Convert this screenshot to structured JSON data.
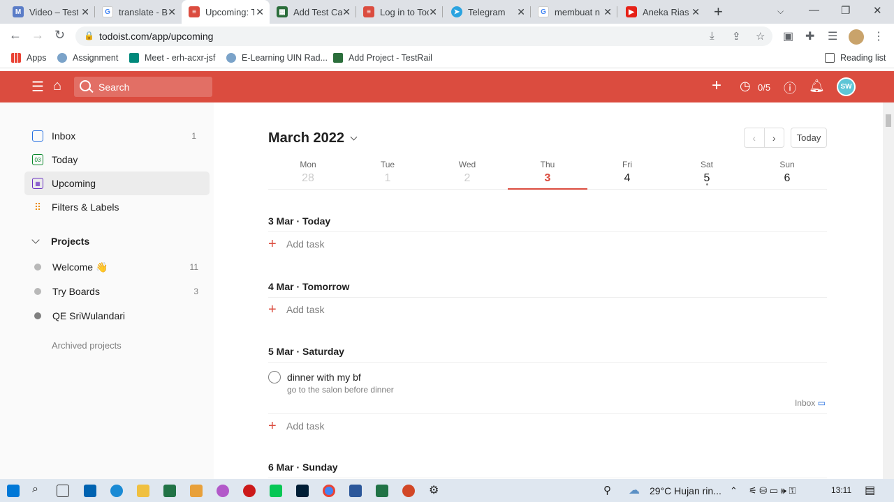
{
  "tabs": [
    {
      "title": "Video – Test",
      "favicon": "M",
      "color": "#5a7cc7"
    },
    {
      "title": "translate - Bing",
      "favicon": "G",
      "color": "#4285f4"
    },
    {
      "title": "Upcoming: Todoist",
      "favicon": "td",
      "color": "#db4c3f"
    },
    {
      "title": "Add Test Case",
      "favicon": "tr",
      "color": "#2b6e3b"
    },
    {
      "title": "Log in to Todoist",
      "favicon": "td",
      "color": "#db4c3f"
    },
    {
      "title": "Telegram",
      "favicon": "tg",
      "color": "#2aa3e0"
    },
    {
      "title": "membuat n",
      "favicon": "G",
      "color": "#4285f4"
    },
    {
      "title": "Aneka Rias",
      "favicon": "yt",
      "color": "#e62117"
    }
  ],
  "address": {
    "url": "todoist.com/app/upcoming"
  },
  "bookmarks": {
    "apps": "Apps",
    "items": [
      "Assignment",
      "Meet - erh-acxr-jsf",
      "E-Learning UIN Rad...",
      "Add Project - TestRail"
    ],
    "reading_list": "Reading list"
  },
  "header": {
    "search_placeholder": "Search",
    "karma": "0/5",
    "avatar_initials": "SW"
  },
  "sidebar": {
    "nav": [
      {
        "label": "Inbox",
        "count": "1",
        "icon": "inbox-icon",
        "color": "#246fe0"
      },
      {
        "label": "Today",
        "count": "",
        "icon": "calendar-today-icon",
        "color": "#058527"
      },
      {
        "label": "Upcoming",
        "count": "",
        "icon": "calendar-upcoming-icon",
        "color": "#692fc2"
      },
      {
        "label": "Filters & Labels",
        "count": "",
        "icon": "filters-icon",
        "color": "#eb8909"
      }
    ],
    "projects_heading": "Projects",
    "projects": [
      {
        "label": "Welcome 👋",
        "count": "11",
        "color": "#b8b8b8"
      },
      {
        "label": "Try Boards",
        "count": "3",
        "color": "#b8b8b8"
      },
      {
        "label": "QE SriWulandari",
        "count": "",
        "color": "#808080"
      }
    ],
    "archived": "Archived projects"
  },
  "main": {
    "month": "March 2022",
    "today_button": "Today",
    "week": [
      {
        "name": "Mon",
        "date": "28",
        "state": "past"
      },
      {
        "name": "Tue",
        "date": "1",
        "state": "past"
      },
      {
        "name": "Wed",
        "date": "2",
        "state": "past"
      },
      {
        "name": "Thu",
        "date": "3",
        "state": "today"
      },
      {
        "name": "Fri",
        "date": "4",
        "state": "future"
      },
      {
        "name": "Sat",
        "date": "5",
        "state": "future"
      },
      {
        "name": "Sun",
        "date": "6",
        "state": "future"
      }
    ],
    "sections": [
      {
        "date": "3 Mar",
        "label": "Today"
      },
      {
        "date": "4 Mar",
        "label": "Tomorrow"
      },
      {
        "date": "5 Mar",
        "label": "Saturday"
      },
      {
        "date": "6 Mar",
        "label": "Sunday"
      }
    ],
    "add_task": "Add task",
    "task": {
      "name": "dinner with my bf",
      "description": "go to the salon before dinner",
      "project": "Inbox"
    }
  },
  "taskbar": {
    "weather": "29°C  Hujan rin...",
    "time": "13:11"
  }
}
